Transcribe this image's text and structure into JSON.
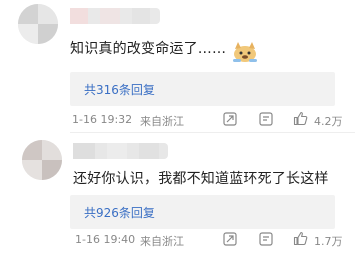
{
  "comments": [
    {
      "text": "知识真的改变命运了……",
      "emoji_icon": "doge-emoji-icon",
      "replies_label": "共316条回复",
      "time": "1-16 19:32",
      "location": "来自浙江",
      "likes": "4.2万"
    },
    {
      "text": "还好你认识，我都不知道蓝环死了长这样",
      "replies_label": "共926条回复",
      "time": "1-16 19:40",
      "location": "来自浙江",
      "likes": "1.7万"
    }
  ],
  "colors": {
    "link": "#3a6fc4",
    "text": "#222222",
    "meta": "#888888",
    "reply_bg": "#f2f2f2"
  },
  "icons": [
    "share-icon",
    "comment-icon",
    "like-icon"
  ]
}
